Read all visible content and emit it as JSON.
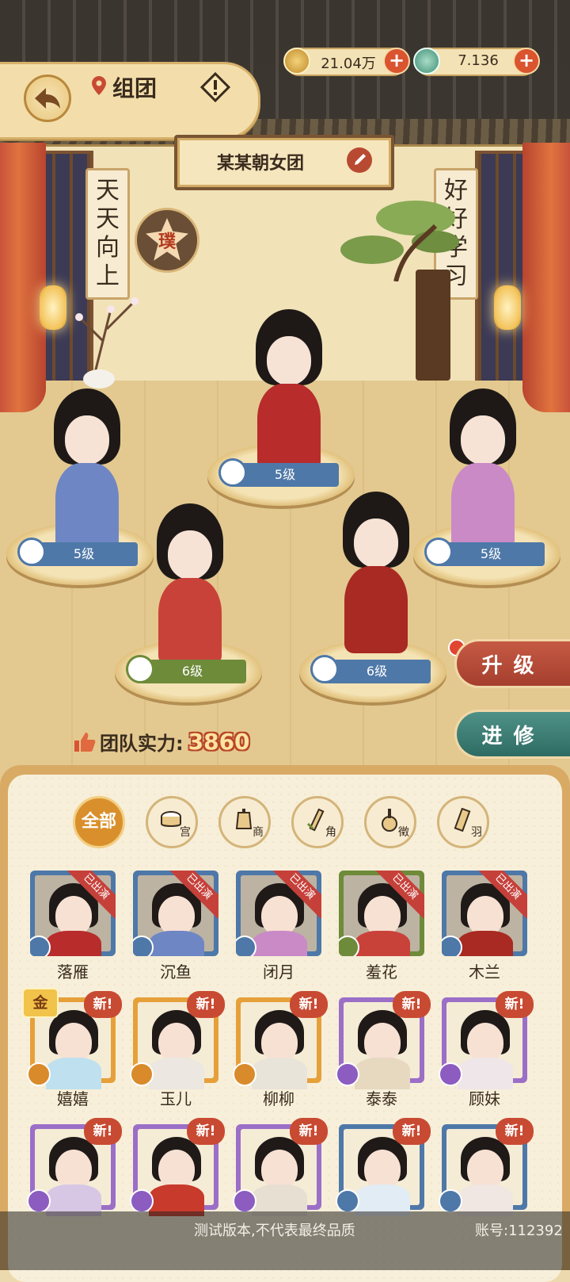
{
  "header": {
    "title": "组团"
  },
  "currency": [
    {
      "name": "coin",
      "value": "21.04万",
      "color": "#d7a43b"
    },
    {
      "name": "jade",
      "value": "7.136",
      "color": "#5aa58b"
    }
  ],
  "team": {
    "name": "某某朝女团"
  },
  "decor": {
    "left_scroll": "天天向上",
    "right_scroll": "好好学习",
    "seal": "璞"
  },
  "lineup": [
    {
      "slot": "top-center",
      "level": "5级",
      "role_color": "#4e78a8",
      "robe": "#b82c2c"
    },
    {
      "slot": "left",
      "level": "5级",
      "role_color": "#4e78a8",
      "robe": "#6f86c4"
    },
    {
      "slot": "right",
      "level": "5级",
      "role_color": "#4e78a8",
      "robe": "#c98ac6"
    },
    {
      "slot": "bottom-left",
      "level": "6级",
      "role_color": "#6e8b3a",
      "robe": "#c9423a"
    },
    {
      "slot": "bottom-right",
      "level": "6级",
      "role_color": "#4e78a8",
      "robe": "#a82a22"
    }
  ],
  "actions": {
    "upgrade": "升级",
    "train": "进修"
  },
  "power": {
    "label": "团队实力:",
    "value": "3860"
  },
  "filters": [
    {
      "label": "全部"
    },
    {
      "label": "宫"
    },
    {
      "label": "商"
    },
    {
      "label": "角"
    },
    {
      "label": "徵"
    },
    {
      "label": "羽"
    }
  ],
  "roster": {
    "deployed_label": "已出演",
    "new_label": "新!",
    "gold_label": "金",
    "rows": [
      [
        {
          "name": "落雁",
          "status": "deployed",
          "frame": "#4e78a8",
          "robe": "#b82c2c",
          "role": "#4e78a8"
        },
        {
          "name": "沉鱼",
          "status": "deployed",
          "frame": "#4e78a8",
          "robe": "#6f86c4",
          "role": "#4e78a8"
        },
        {
          "name": "闭月",
          "status": "deployed",
          "frame": "#4e78a8",
          "robe": "#c98ac6",
          "role": "#4e78a8"
        },
        {
          "name": "羞花",
          "status": "deployed",
          "frame": "#6e8b3a",
          "robe": "#c9423a",
          "role": "#6e8b3a"
        },
        {
          "name": "木兰",
          "status": "deployed",
          "frame": "#4e78a8",
          "robe": "#a82a22",
          "role": "#4e78a8"
        }
      ],
      [
        {
          "name": "嬉嬉",
          "status": "new",
          "frame": "#e6a03a",
          "robe": "#bfe0ef",
          "role": "#d98a2a",
          "gold": true
        },
        {
          "name": "玉儿",
          "status": "new",
          "frame": "#e6a03a",
          "robe": "#ece7e0",
          "role": "#d98a2a"
        },
        {
          "name": "柳柳",
          "status": "new",
          "frame": "#e6a03a",
          "robe": "#e9e4da",
          "role": "#d98a2a"
        },
        {
          "name": "泰泰",
          "status": "new",
          "frame": "#9b6fc7",
          "robe": "#e7d8c0",
          "role": "#8c5cc0"
        },
        {
          "name": "顾妹",
          "status": "new",
          "frame": "#9b6fc7",
          "robe": "#efe6ea",
          "role": "#8c5cc0"
        }
      ],
      [
        {
          "name": "",
          "status": "new",
          "frame": "#9b6fc7",
          "robe": "#d8c7e4",
          "role": "#8c5cc0"
        },
        {
          "name": "",
          "status": "new",
          "frame": "#9b6fc7",
          "robe": "#c83a2c",
          "role": "#8c5cc0"
        },
        {
          "name": "",
          "status": "new",
          "frame": "#9b6fc7",
          "robe": "#e7dfd2",
          "role": "#8c5cc0"
        },
        {
          "name": "",
          "status": "new",
          "frame": "#4e78a8",
          "robe": "#e2ecf4",
          "role": "#4e78a8"
        },
        {
          "name": "",
          "status": "new",
          "frame": "#4e78a8",
          "robe": "#f0e6e2",
          "role": "#4e78a8"
        }
      ]
    ]
  },
  "footer": {
    "watermark": "测试版本,不代表最终品质",
    "account": "账号:112392"
  }
}
